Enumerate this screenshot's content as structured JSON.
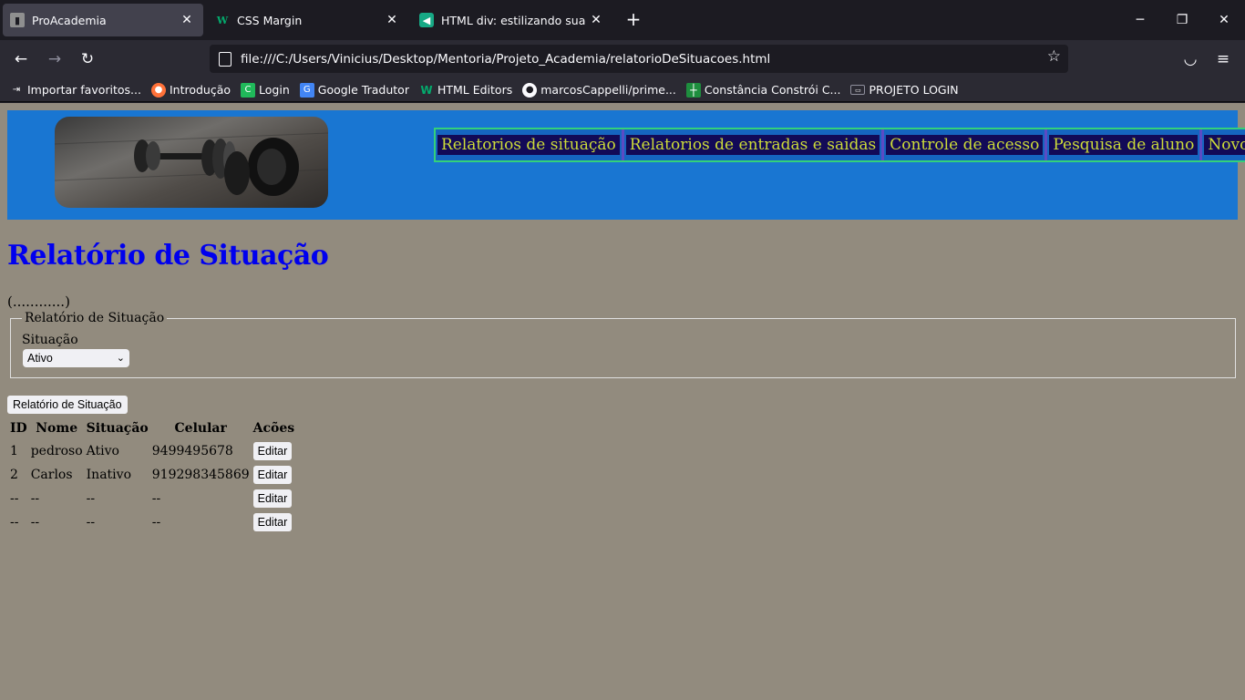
{
  "browser": {
    "tabs": [
      {
        "title": "ProAcademia",
        "active": true
      },
      {
        "title": "CSS Margin",
        "active": false
      },
      {
        "title": "HTML div: estilizando sua págin",
        "active": false
      }
    ],
    "url": "file:///C:/Users/Vinicius/Desktop/Mentoria/Projeto_Academia/relatorioDeSituacoes.html",
    "bookmarks": [
      {
        "label": "Importar favoritos...",
        "icon": "import-icon"
      },
      {
        "label": "Introdução",
        "icon": "firefox-icon"
      },
      {
        "label": "Login",
        "icon": "login-icon"
      },
      {
        "label": "Google Tradutor",
        "icon": "translate-icon"
      },
      {
        "label": "HTML Editors",
        "icon": "w3schools-icon"
      },
      {
        "label": "marcosCappelli/prime...",
        "icon": "github-icon"
      },
      {
        "label": "Constância Constrói C...",
        "icon": "cross-icon"
      },
      {
        "label": "PROJETO LOGIN",
        "icon": "keyboard-icon"
      }
    ]
  },
  "header": {
    "menu": [
      "Relatorios de situação",
      "Relatorios de entradas e saidas",
      "Controle de acesso",
      "Pesquisa de aluno",
      "Novo aluno"
    ]
  },
  "main": {
    "title": "Relatório de Situação",
    "placeholder_text": "(............)",
    "fieldset_legend": "Relatório de Situação",
    "situacao_label": "Situação",
    "situacao_selected": "Ativo",
    "report_button": "Relatório de Situação",
    "table": {
      "headers": [
        "ID",
        "Nome",
        "Situação",
        "Celular",
        "Acões"
      ],
      "rows": [
        [
          "1",
          "pedroso",
          "Ativo",
          "9499495678",
          "Editar"
        ],
        [
          "2",
          "Carlos",
          "Inativo",
          "919298345869",
          "Editar"
        ],
        [
          "--",
          "--",
          "--",
          "--",
          "Editar"
        ],
        [
          "--",
          "--",
          "--",
          "--",
          "Editar"
        ]
      ]
    }
  },
  "colors": {
    "page_bg": "#928b7e",
    "header_bg": "#1976d2",
    "menu_text": "#cddc39",
    "menu_item_bg": "#120a57",
    "title": "#0000ee"
  }
}
